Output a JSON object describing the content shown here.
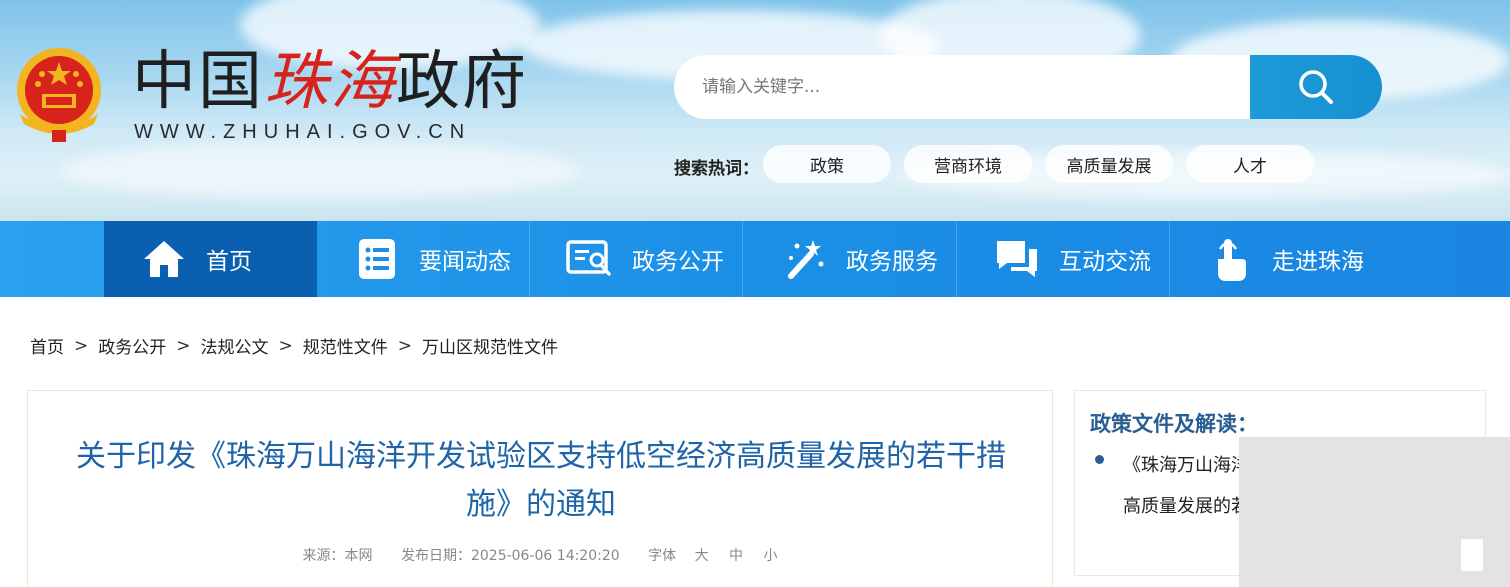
{
  "header": {
    "title_black_1": "中国",
    "title_red": "珠海",
    "title_black_2": "政府",
    "url": "WWW.ZHUHAI.GOV.CN"
  },
  "search": {
    "placeholder": "请输入关键字...",
    "hot_label": "搜索热词：",
    "hot_tags": [
      "政策",
      "营商环境",
      "高质量发展",
      "人才"
    ]
  },
  "nav": {
    "items": [
      {
        "label": "首页",
        "icon": "home-icon"
      },
      {
        "label": "要闻动态",
        "icon": "news-list-icon"
      },
      {
        "label": "政务公开",
        "icon": "document-search-icon"
      },
      {
        "label": "政务服务",
        "icon": "magic-wand-icon"
      },
      {
        "label": "互动交流",
        "icon": "chat-bubbles-icon"
      },
      {
        "label": "走进珠海",
        "icon": "pointing-hand-icon"
      }
    ]
  },
  "breadcrumb": {
    "items": [
      "首页",
      "政务公开",
      "法规公文",
      "规范性文件",
      "万山区规范性文件"
    ],
    "separator": ">"
  },
  "article": {
    "title": "关于印发《珠海万山海洋开发试验区支持低空经济高质量发展的若干措施》的通知",
    "source_label": "来源：本网",
    "date_label": "发布日期：",
    "date": "2025-06-06 14:20:20",
    "font_label": "字体",
    "font_large": "大",
    "font_medium": "中",
    "font_small": "小"
  },
  "side": {
    "title": "政策文件及解读：",
    "link_text": "《珠海万山海洋开发试验区支持低空经济高质量发展的若干措施》政策解读"
  },
  "colors": {
    "nav_bg": "#1b8fe6",
    "nav_active": "#0b5fb0",
    "title_blue": "#1f64a8",
    "red_accent": "#d8231c"
  }
}
